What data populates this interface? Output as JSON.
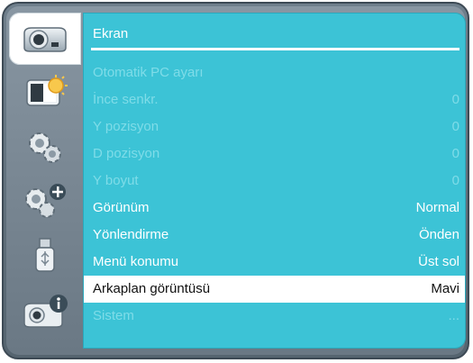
{
  "panel": {
    "title": "Ekran"
  },
  "menu": [
    {
      "label": "Otomatik PC ayarı",
      "value": "",
      "state": "disabled"
    },
    {
      "label": "İnce senkr.",
      "value": "0",
      "state": "disabled"
    },
    {
      "label": "Y pozisyon",
      "value": "0",
      "state": "disabled"
    },
    {
      "label": "D pozisyon",
      "value": "0",
      "state": "disabled"
    },
    {
      "label": "Y boyut",
      "value": "0",
      "state": "disabled"
    },
    {
      "label": "Görünüm",
      "value": "Normal",
      "state": "enabled"
    },
    {
      "label": "Yönlendirme",
      "value": "Önden",
      "state": "enabled"
    },
    {
      "label": "Menü konumu",
      "value": "Üst sol",
      "state": "enabled"
    },
    {
      "label": "Arkaplan görüntüsü",
      "value": "Mavi",
      "state": "selected"
    },
    {
      "label": "Sistem",
      "value": "...",
      "state": "disabled"
    }
  ],
  "sidebar": {
    "items": [
      {
        "icon": "projector-icon",
        "active": true
      },
      {
        "icon": "picture-brightness-icon",
        "active": false
      },
      {
        "icon": "gears-icon",
        "active": false
      },
      {
        "icon": "gears-plus-icon",
        "active": false
      },
      {
        "icon": "usb-drive-icon",
        "active": false
      },
      {
        "icon": "projector-info-icon",
        "active": false
      }
    ]
  },
  "colors": {
    "panel": "#3cc3d6",
    "frame": "#6a7884",
    "disabled_text": "#7fdce8"
  }
}
